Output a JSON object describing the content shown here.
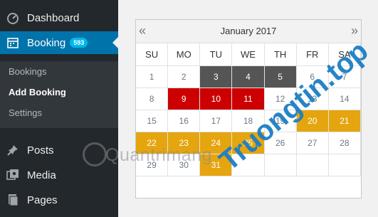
{
  "sidebar": {
    "dashboard": "Dashboard",
    "booking": "Booking",
    "booking_count": "593",
    "submenu": [
      "Bookings",
      "Add Booking",
      "Settings"
    ],
    "posts": "Posts",
    "media": "Media",
    "pages": "Pages"
  },
  "calendar": {
    "title": "January 2017",
    "prev": "«",
    "next": "»",
    "weekdays": [
      "SU",
      "MO",
      "TU",
      "WE",
      "TH",
      "FR",
      "SA"
    ],
    "rows": [
      [
        "1",
        "2",
        "3",
        "4",
        "5",
        "6",
        "7"
      ],
      [
        "8",
        "9",
        "10",
        "11",
        "12",
        "13",
        "14"
      ],
      [
        "15",
        "16",
        "17",
        "18",
        "19",
        "20",
        "21"
      ],
      [
        "22",
        "23",
        "24",
        "25",
        "26",
        "27",
        "28"
      ],
      [
        "29",
        "30",
        "31",
        "",
        "",
        "",
        ""
      ]
    ],
    "status_colors": {
      "grey": "#555555",
      "red": "#cc0000",
      "gold": "#e5a50f"
    }
  },
  "watermarks": {
    "quantrimang": "Quantrimang",
    "truongtin": "Truongtin.top"
  }
}
